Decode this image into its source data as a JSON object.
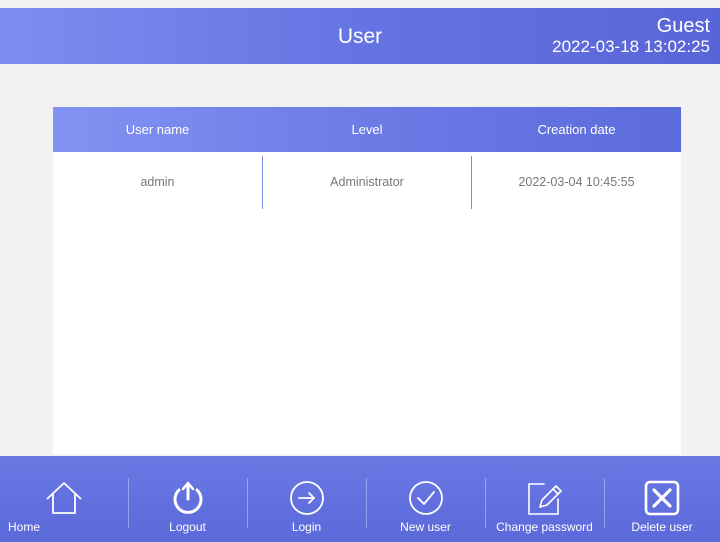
{
  "header": {
    "title": "User",
    "user": "Guest",
    "datetime": "2022-03-18 13:02:25"
  },
  "table": {
    "columns": [
      "User name",
      "Level",
      "Creation date"
    ],
    "rows": [
      [
        "admin",
        "Administrator",
        "2022-03-04 10:45:55"
      ]
    ]
  },
  "toolbar": {
    "buttons": [
      {
        "label": "Home",
        "icon": "home-icon"
      },
      {
        "label": "Logout",
        "icon": "power-icon"
      },
      {
        "label": "Login",
        "icon": "arrow-right-circle-icon"
      },
      {
        "label": "New user",
        "icon": "check-circle-icon"
      },
      {
        "label": "Change password",
        "icon": "edit-pen-icon"
      },
      {
        "label": "Delete user",
        "icon": "close-box-icon"
      }
    ]
  },
  "colors": {
    "accent": "#6574e2",
    "background": "#f2f2f4",
    "text_muted": "#777777"
  }
}
